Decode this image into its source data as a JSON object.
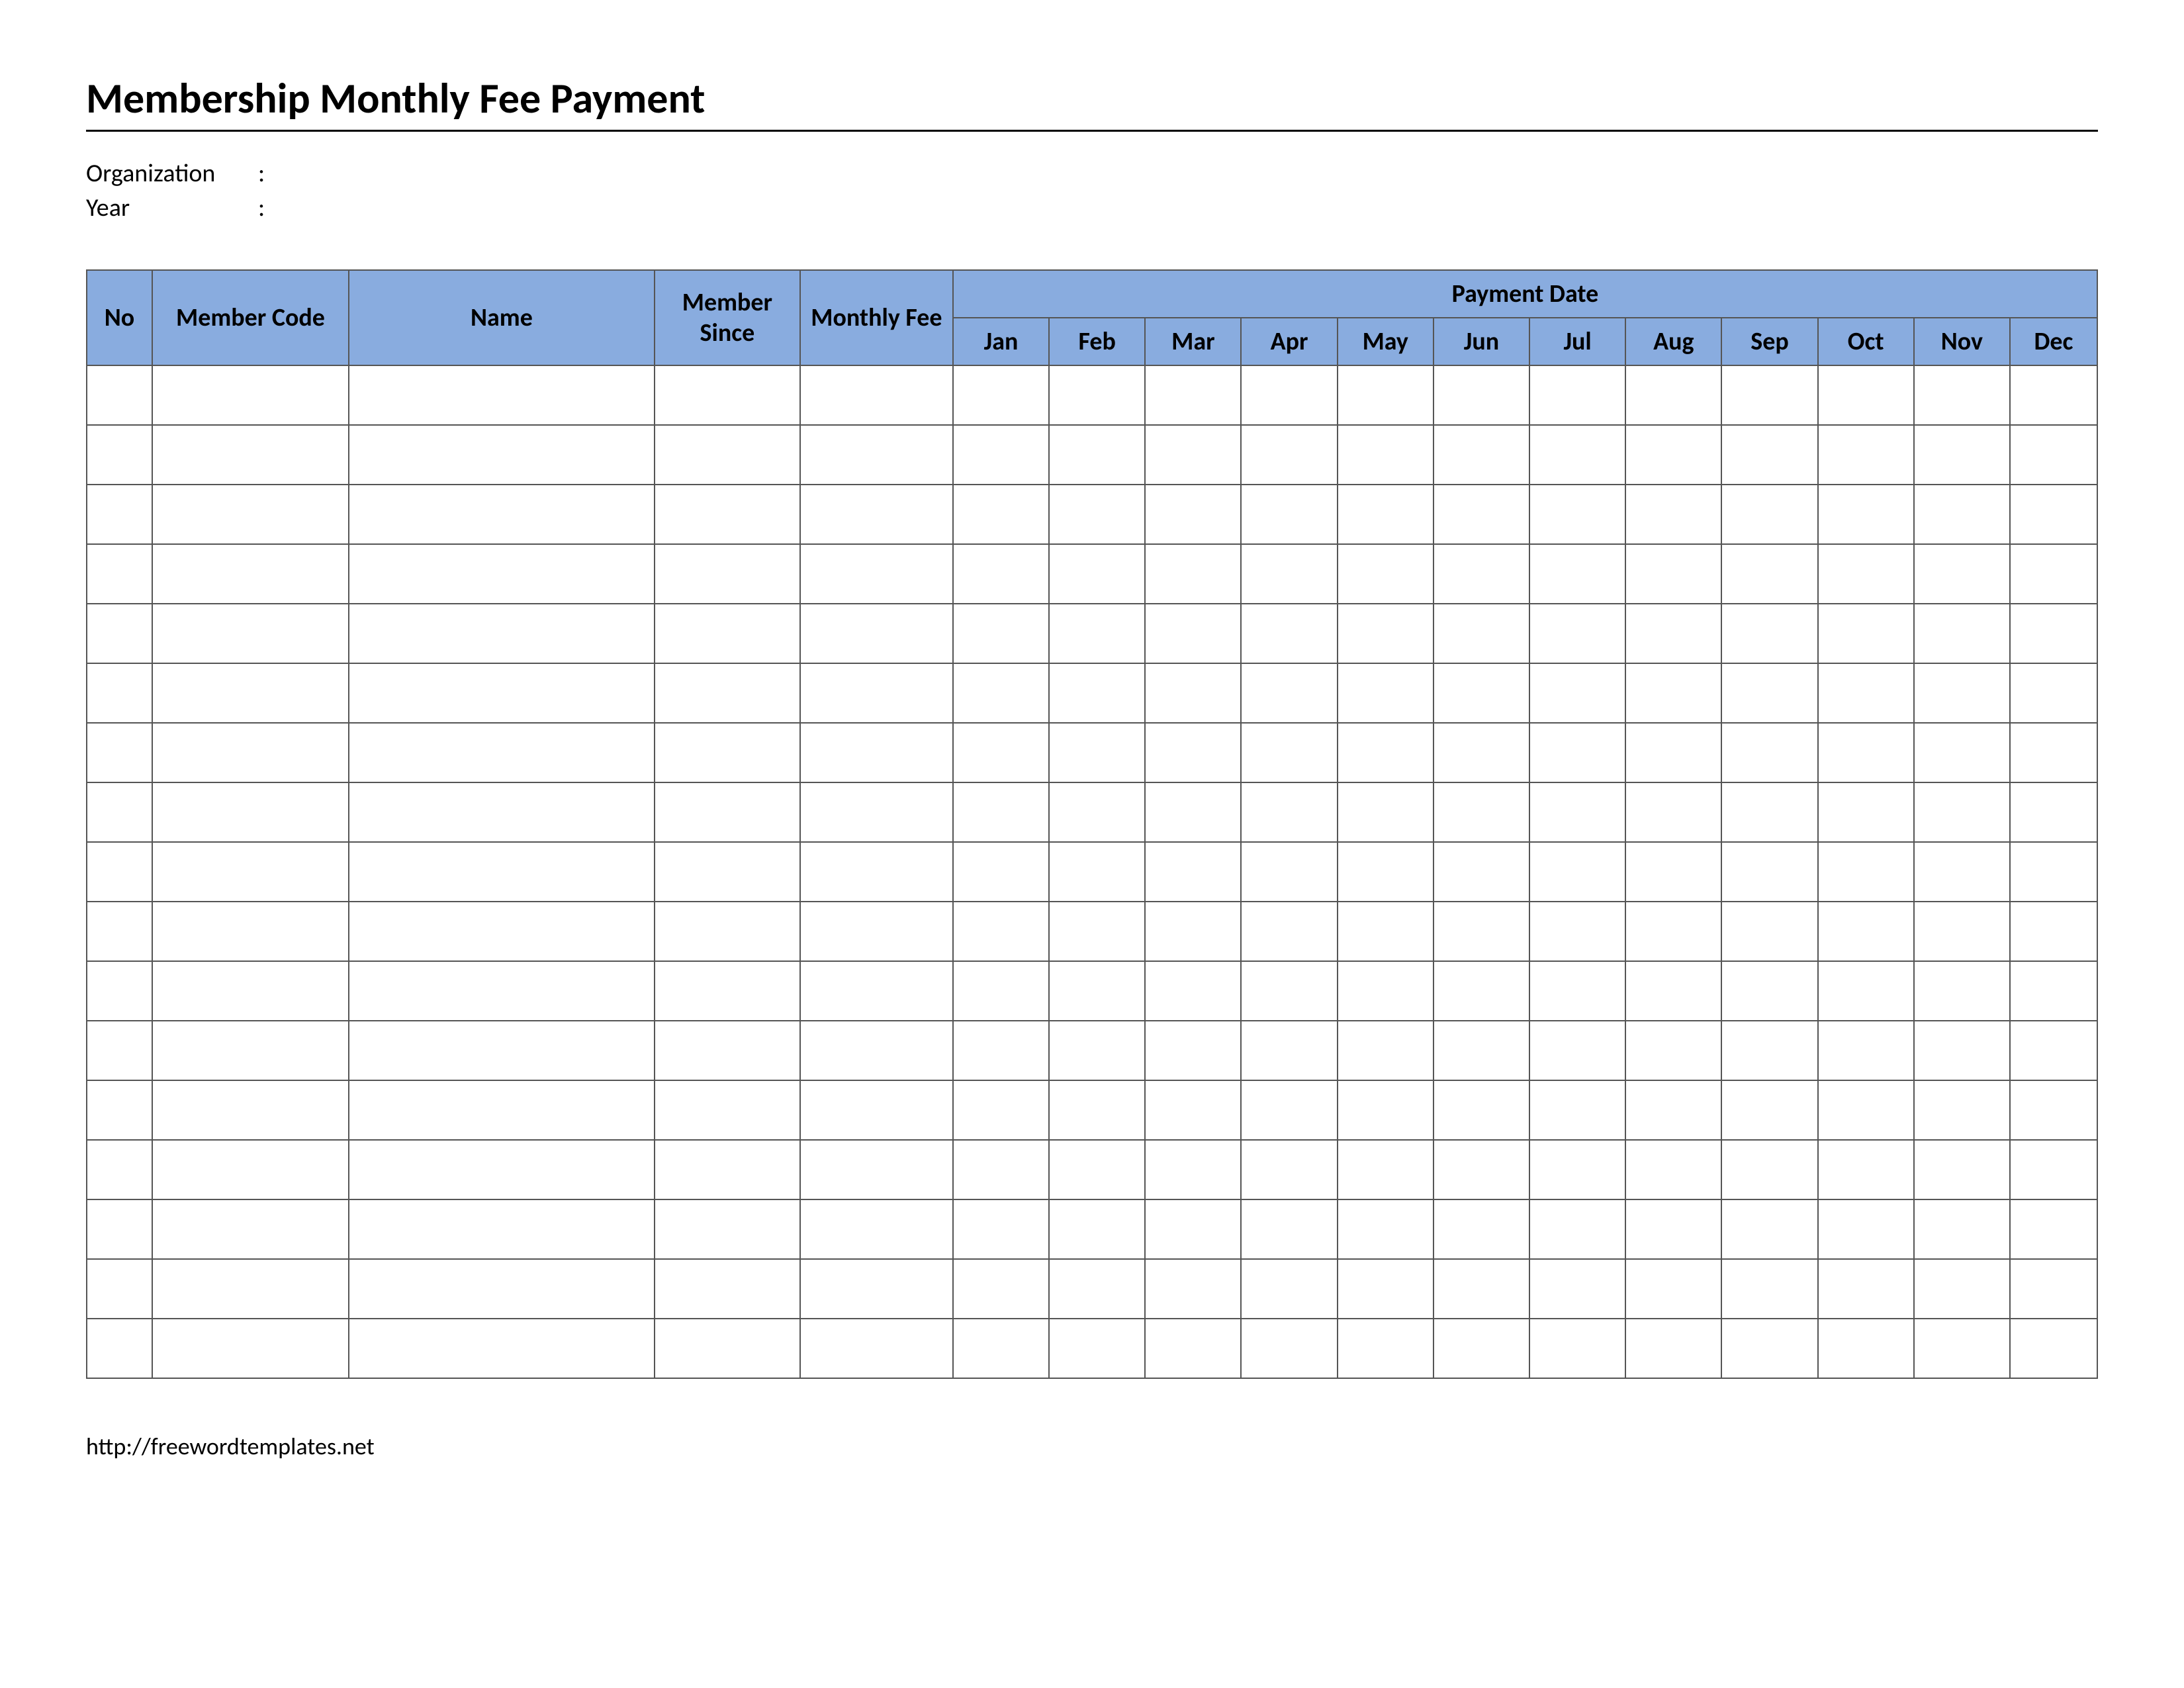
{
  "title": "Membership Monthly Fee Payment",
  "meta": {
    "organization_label": "Organization",
    "year_label": "Year",
    "colon": ":"
  },
  "table": {
    "headers": {
      "no": "No",
      "member_code": "Member Code",
      "name": "Name",
      "member_since": "Member Since",
      "monthly_fee": "Monthly Fee",
      "payment_date": "Payment Date"
    },
    "months": [
      "Jan",
      "Feb",
      "Mar",
      "Apr",
      "May",
      "Jun",
      "Jul",
      "Aug",
      "Sep",
      "Oct",
      "Nov",
      "Dec"
    ],
    "row_count": 17
  },
  "footer": {
    "url": "http://freewordtemplates.net"
  }
}
